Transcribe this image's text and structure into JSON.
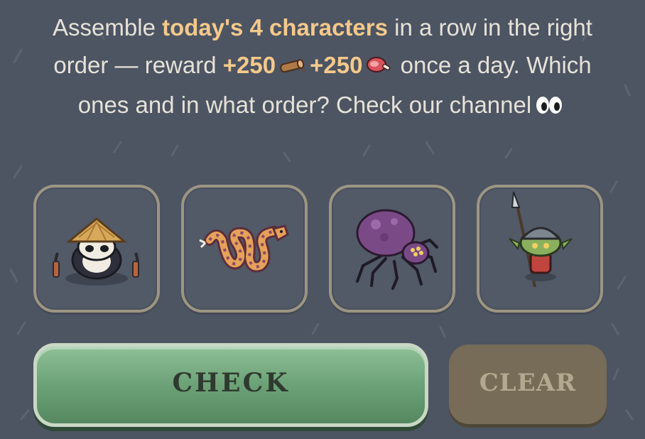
{
  "prompt": {
    "t1": "Assemble ",
    "highlight1": "today's 4 characters",
    "t2": " in a row in the right order — reward ",
    "reward1": "+250",
    "reward2": "+250",
    "t3": " once a day. Which ones and in what order? Check our channel"
  },
  "icons": {
    "reward1": "wood-log-icon",
    "reward2": "meat-icon",
    "channel": "eyes-icon"
  },
  "slots": [
    {
      "character": "panda-ninja"
    },
    {
      "character": "snake"
    },
    {
      "character": "spider"
    },
    {
      "character": "goblin-spearman"
    }
  ],
  "buttons": {
    "check": "CHECK",
    "clear": "CLEAR"
  },
  "colors": {
    "background": "#4d5462",
    "highlight": "#f3c98b",
    "check": "#6fa47a",
    "clear": "#766c57"
  }
}
